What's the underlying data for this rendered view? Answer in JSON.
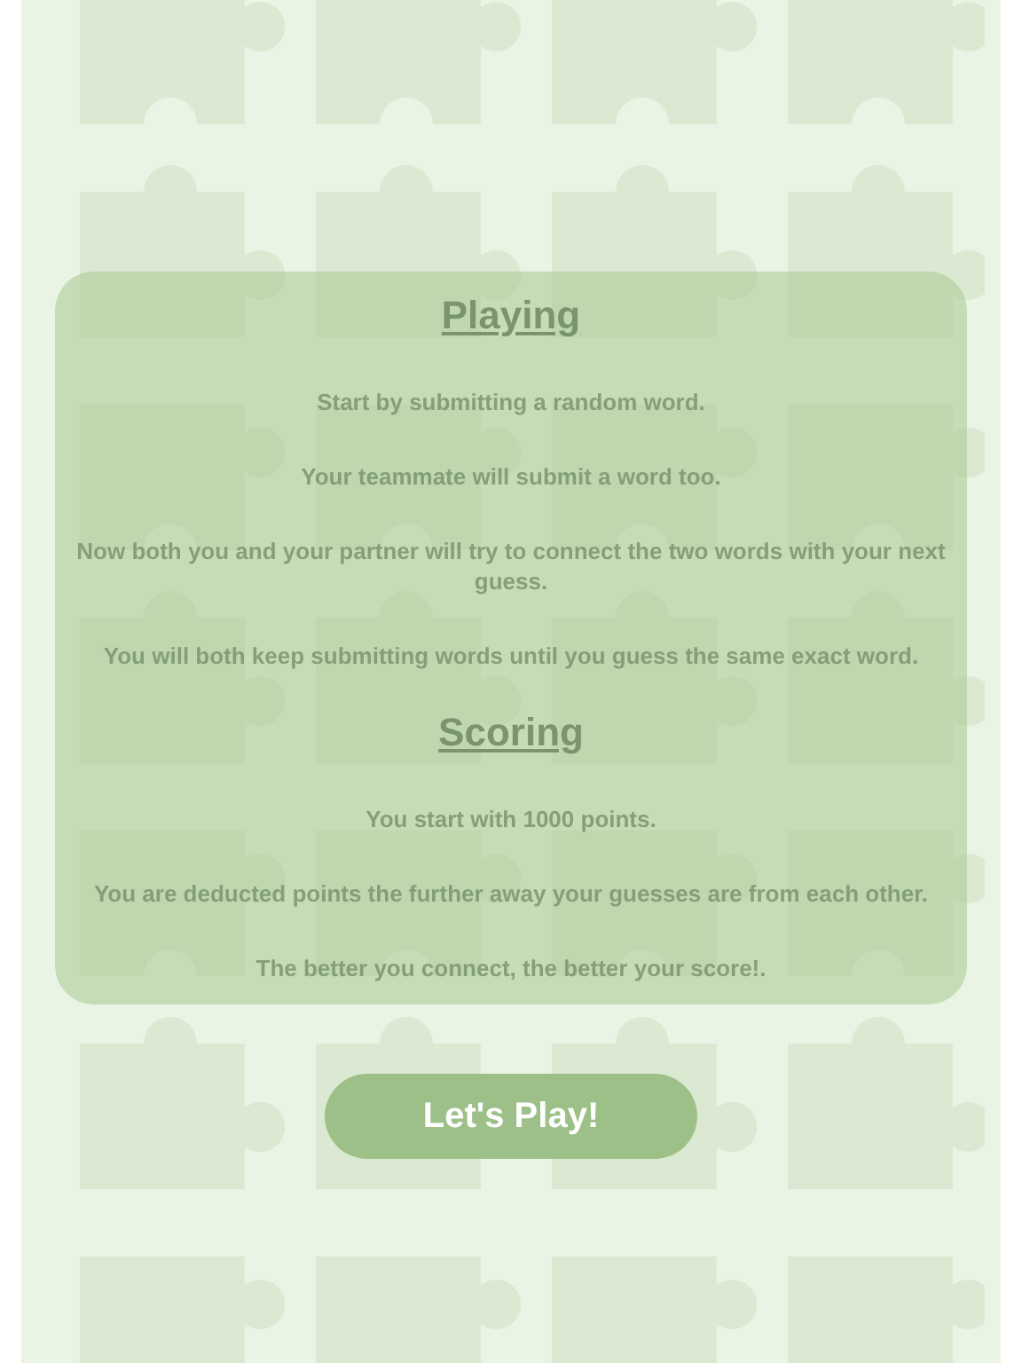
{
  "sections": [
    {
      "heading": "Playing",
      "paragraphs": [
        "Start by submitting a random word.",
        "Your teammate will submit a word too.",
        "Now both you and your partner will try to connect the two words with your next guess.",
        "You will both keep submitting words until you guess the same exact word."
      ]
    },
    {
      "heading": "Scoring",
      "paragraphs": [
        "You start with 1000 points.",
        "You are deducted points the further away your guesses are from each other.",
        "The better you connect, the better your score!."
      ]
    }
  ],
  "play_button": {
    "label": "Let's Play!"
  }
}
